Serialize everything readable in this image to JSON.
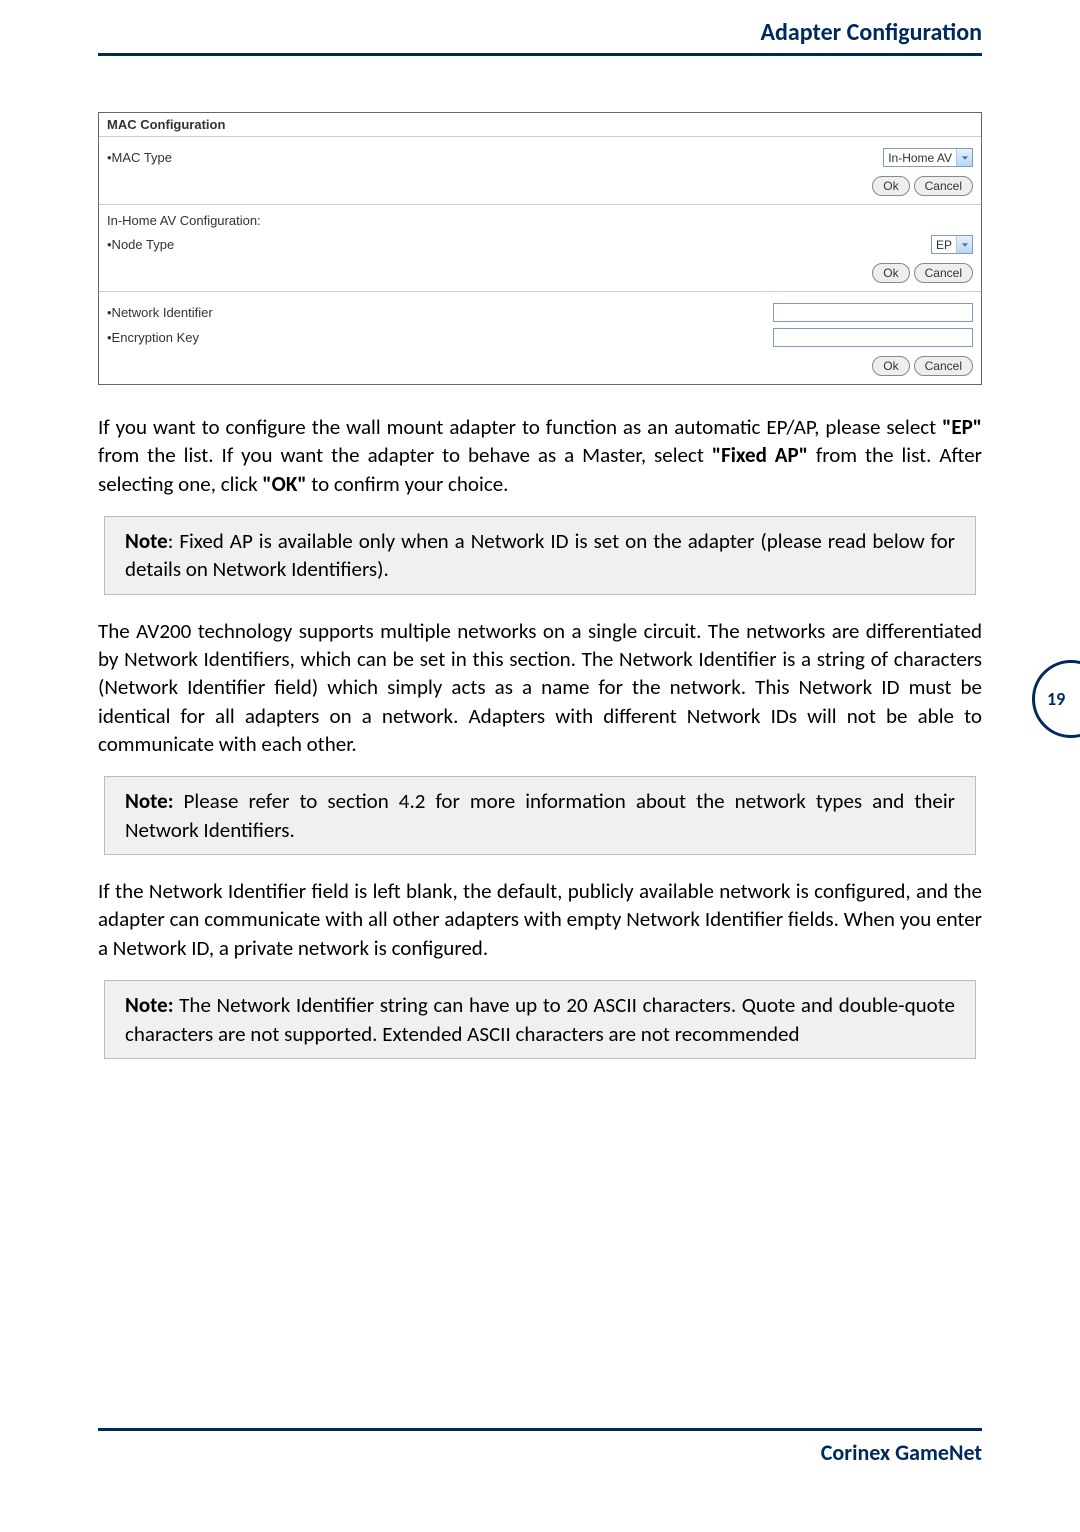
{
  "header": {
    "title": "Adapter Configuration"
  },
  "panel": {
    "title": "MAC Configuration",
    "mac_type": {
      "label": "•MAC Type",
      "value": "In-Home AV"
    },
    "inhome_label": "In-Home AV Configuration:",
    "node_type": {
      "label": "•Node Type",
      "value": "EP"
    },
    "net_id": {
      "label": "•Network Identifier",
      "value": ""
    },
    "enc_key": {
      "label": "•Encryption Key",
      "value": ""
    },
    "ok": "Ok",
    "cancel": "Cancel"
  },
  "para1": {
    "t1": "If you want to configure the wall mount adapter to function as an automatic EP/AP, please select ",
    "b1": "\"EP\"",
    "t2": " from the list. If you want the adapter to behave as a Master, select ",
    "b2": "\"Fixed AP\"",
    "t3": " from the list. After selecting one, click ",
    "b3": "\"OK\"",
    "t4": " to confirm your choice."
  },
  "note1": {
    "b": "Note",
    "t": ": Fixed AP is available only when a Network ID is set on the adapter (please read below for details on Network Identifiers)."
  },
  "para2": "The AV200 technology supports multiple networks on a single circuit. The networks are differentiated by Network Identifiers, which can be set in this section. The Network Identifier is a string of characters (Network Identifier field) which simply acts as a name for the network. This Network ID must be identical for all adapters on a network. Adapters with different Network IDs will not be able to communicate with each other.",
  "note2": {
    "b": "Note:",
    "t": " Please refer to section 4.2 for more information about the network types and their Network Identifiers."
  },
  "para3": "If the Network Identifier field is left blank, the default, publicly available network is configured, and the adapter can communicate with all other adapters with empty Network Identifier fields. When you enter a Network ID, a private network is configured.",
  "note3": {
    "b": "Note:",
    "t": " The Network Identifier string can have up to 20 ASCII characters. Quote and double-quote characters are not supported. Extended ASCII characters are not recommended"
  },
  "page_number": "19",
  "footer": "Corinex GameNet"
}
